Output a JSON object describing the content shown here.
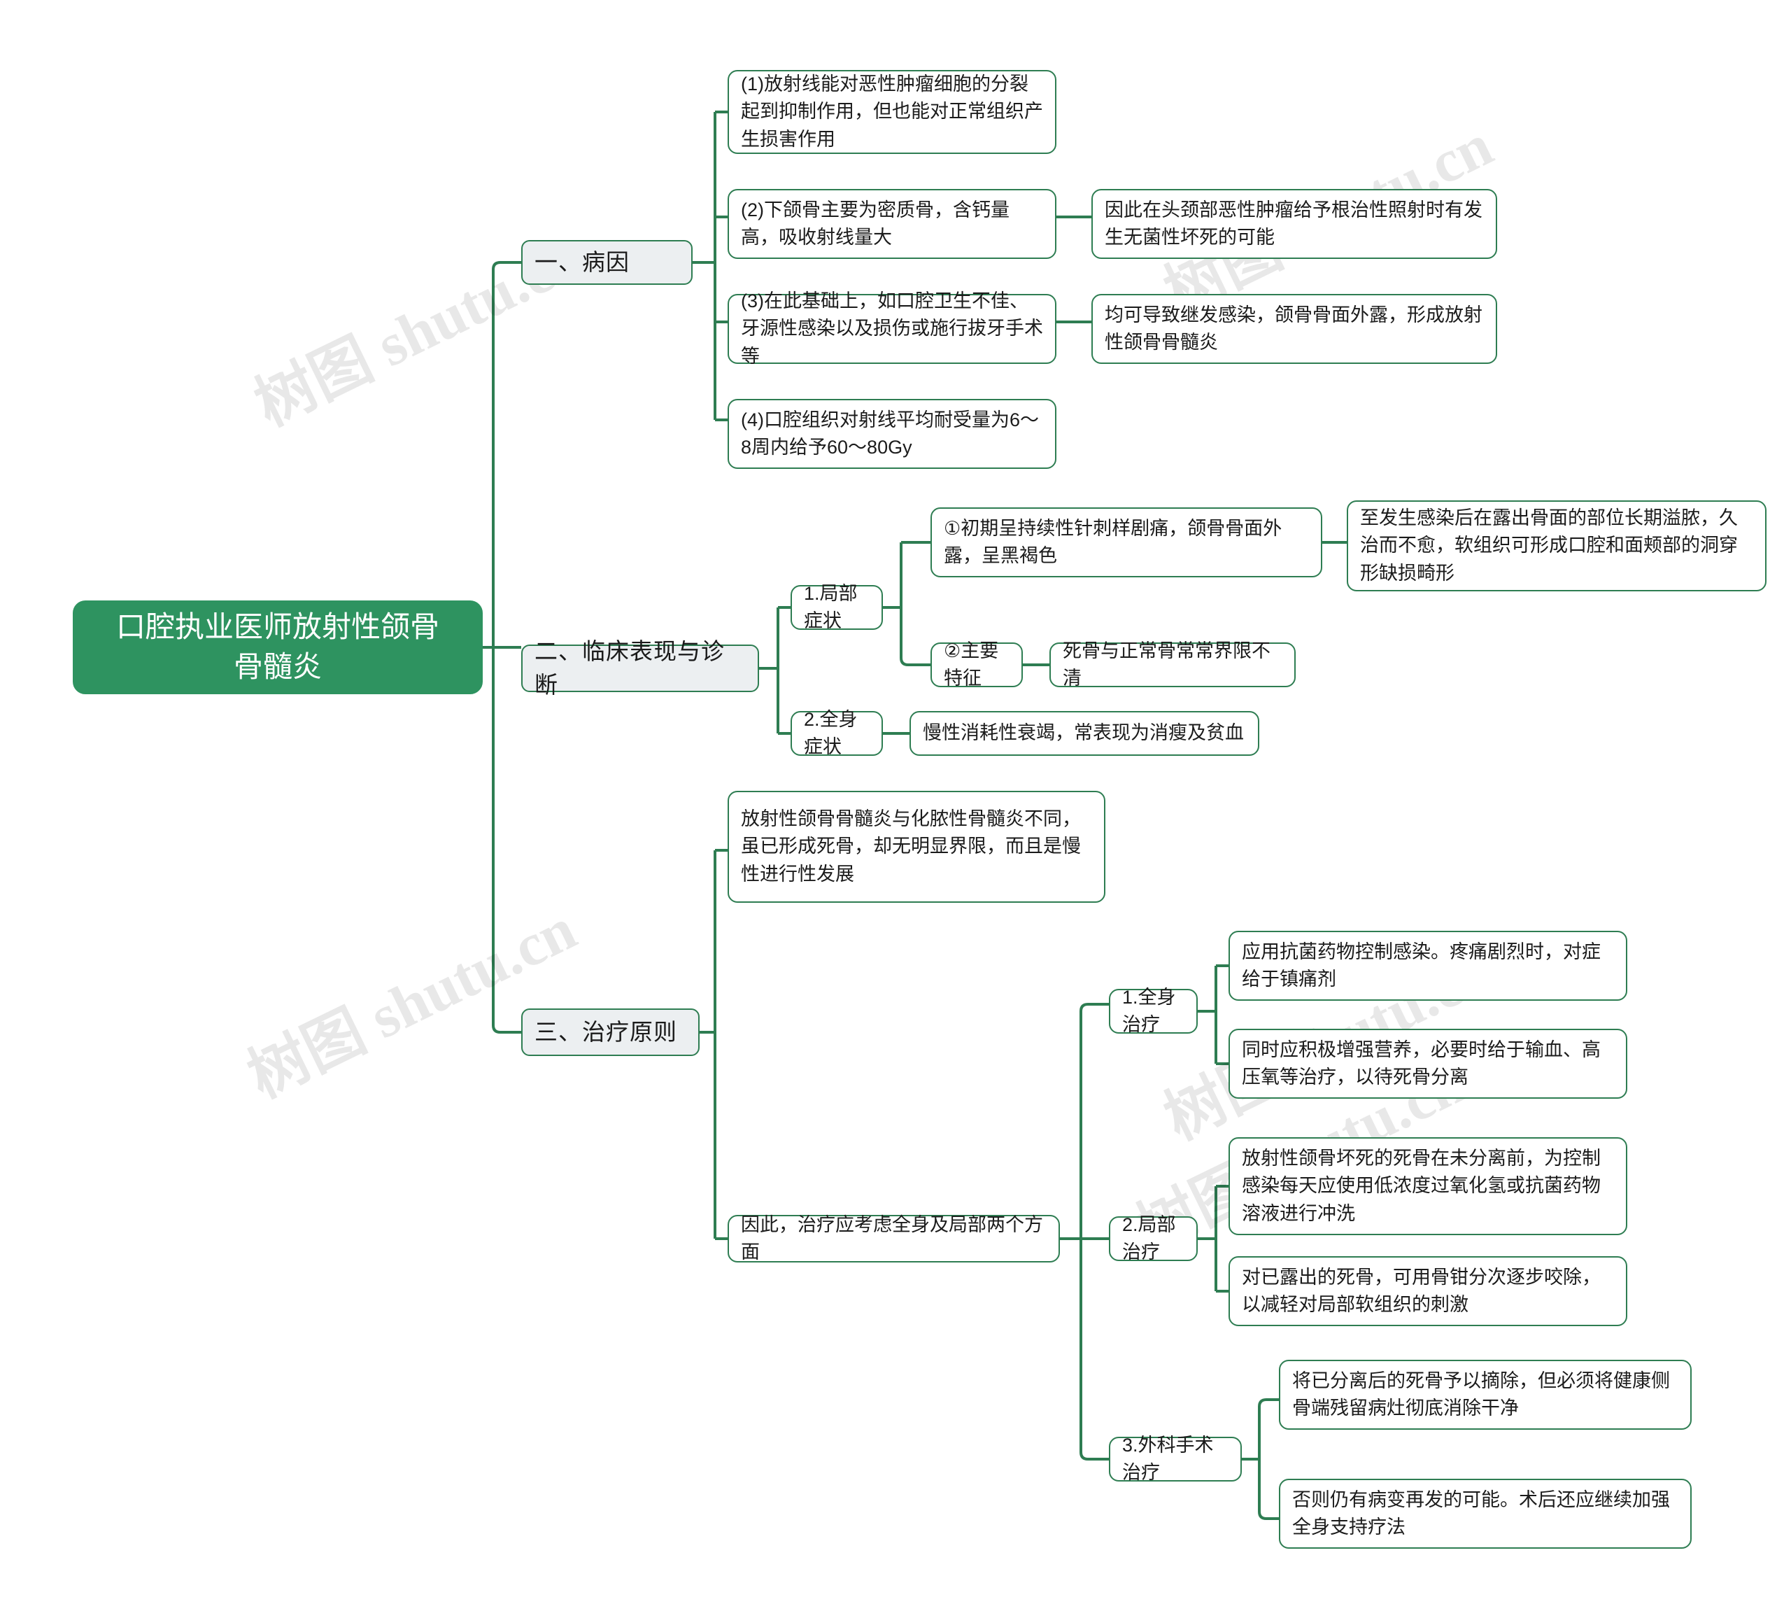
{
  "meta": {
    "title": "口腔执业医师放射性颌骨骨髓炎 思维导图",
    "accent_green": "#2e9360",
    "line_green": "#2e7d52",
    "branch_fill": "#eceff1",
    "node_fill": "#ffffff",
    "text_color": "#1b1b1b",
    "background": "#ffffff"
  },
  "watermarks": [
    {
      "text": "树图 shutu.cn"
    },
    {
      "text": "树图 shutu.cn"
    },
    {
      "text": "树图 shutu.cn"
    },
    {
      "text": "树图 shutu.cn"
    },
    {
      "text": "树图 shutu.cn"
    }
  ],
  "mindmap": {
    "root": {
      "label": "口腔执业医师放射性颌骨\n骨髓炎"
    },
    "branches": [
      {
        "label": "一、病因",
        "children": [
          {
            "label": "(1)放射线能对恶性肿瘤细胞的分裂起到抑制作用，但也能对正常组织产生损害作用",
            "children": []
          },
          {
            "label": "(2)下颌骨主要为密质骨，含钙量高，吸收射线量大",
            "children": [
              {
                "label": "因此在头颈部恶性肿瘤给予根治性照射时有发生无菌性坏死的可能"
              }
            ]
          },
          {
            "label": "(3)在此基础上，如口腔卫生不佳、牙源性感染以及损伤或施行拔牙手术等",
            "children": [
              {
                "label": "均可导致继发感染，颌骨骨面外露，形成放射性颌骨骨髓炎"
              }
            ]
          },
          {
            "label": "(4)口腔组织对射线平均耐受量为6～8周内给予60～80Gy",
            "children": []
          }
        ]
      },
      {
        "label": "二、临床表现与诊断",
        "children": [
          {
            "label": "1.局部症状",
            "children": [
              {
                "label": "①初期呈持续性针刺样剧痛，颌骨骨面外露，呈黑褐色",
                "children": [
                  {
                    "label": "至发生感染后在露出骨面的部位长期溢脓，久治而不愈，软组织可形成口腔和面颊部的洞穿形缺损畸形"
                  }
                ]
              },
              {
                "label": "②主要特征",
                "children": [
                  {
                    "label": "死骨与正常骨常常界限不清"
                  }
                ]
              }
            ]
          },
          {
            "label": "2.全身症状",
            "children": [
              {
                "label": "慢性消耗性衰竭，常表现为消瘦及贫血"
              }
            ]
          }
        ]
      },
      {
        "label": "三、治疗原则",
        "children": [
          {
            "label": "放射性颌骨骨髓炎与化脓性骨髓炎不同，虽已形成死骨，却无明显界限，而且是慢性进行性发展",
            "children": []
          },
          {
            "label": "因此，治疗应考虑全身及局部两个方面",
            "children": [
              {
                "label": "1.全身治疗",
                "children": [
                  {
                    "label": "应用抗菌药物控制感染。疼痛剧烈时，对症给于镇痛剂"
                  },
                  {
                    "label": "同时应积极增强营养，必要时给于输血、高压氧等治疗，以待死骨分离"
                  }
                ]
              },
              {
                "label": "2.局部治疗",
                "children": [
                  {
                    "label": "放射性颌骨坏死的死骨在未分离前，为控制感染每天应使用低浓度过氧化氢或抗菌药物溶液进行冲洗"
                  },
                  {
                    "label": "对已露出的死骨，可用骨钳分次逐步咬除，以减轻对局部软组织的刺激"
                  }
                ]
              },
              {
                "label": "3.外科手术治疗",
                "children": [
                  {
                    "label": "将已分离后的死骨予以摘除，但必须将健康侧骨端残留病灶彻底消除干净"
                  },
                  {
                    "label": "否则仍有病变再发的可能。术后还应继续加强全身支持疗法"
                  }
                ]
              }
            ]
          }
        ]
      }
    ]
  },
  "nodes": {
    "root": {
      "text": "口腔执业医师放射性颌骨\n骨髓炎"
    },
    "b1": {
      "text": "一、病因"
    },
    "b2": {
      "text": "二、临床表现与诊断"
    },
    "b3": {
      "text": "三、治疗原则"
    },
    "c1_1": {
      "text": "(1)放射线能对恶性肿瘤细胞的分裂起到抑制作用，但也能对正常组织产生损害作用"
    },
    "c1_2": {
      "text": "(2)下颌骨主要为密质骨，含钙量高，吸收射线量大"
    },
    "c1_2a": {
      "text": "因此在头颈部恶性肿瘤给予根治性照射时有发生无菌性坏死的可能"
    },
    "c1_3": {
      "text": "(3)在此基础上，如口腔卫生不佳、牙源性感染以及损伤或施行拔牙手术等"
    },
    "c1_3a": {
      "text": "均可导致继发感染，颌骨骨面外露，形成放射性颌骨骨髓炎"
    },
    "c1_4": {
      "text": "(4)口腔组织对射线平均耐受量为6～8周内给予60～80Gy"
    },
    "c2_1": {
      "text": "1.局部症状"
    },
    "c2_1a": {
      "text": "①初期呈持续性针刺样剧痛，颌骨骨面外露，呈黑褐色"
    },
    "c2_1a_x": {
      "text": "至发生感染后在露出骨面的部位长期溢脓，久治而不愈，软组织可形成口腔和面颊部的洞穿形缺损畸形"
    },
    "c2_1b": {
      "text": "②主要特征"
    },
    "c2_1b_x": {
      "text": "死骨与正常骨常常界限不清"
    },
    "c2_2": {
      "text": "2.全身症状"
    },
    "c2_2a": {
      "text": "慢性消耗性衰竭，常表现为消瘦及贫血"
    },
    "c3_1": {
      "text": "放射性颌骨骨髓炎与化脓性骨髓炎不同，虽已形成死骨，却无明显界限，而且是慢性进行性发展"
    },
    "c3_2": {
      "text": "因此，治疗应考虑全身及局部两个方面"
    },
    "c3_2a": {
      "text": "1.全身治疗"
    },
    "c3_2a_x1": {
      "text": "应用抗菌药物控制感染。疼痛剧烈时，对症给于镇痛剂"
    },
    "c3_2a_x2": {
      "text": "同时应积极增强营养，必要时给于输血、高压氧等治疗，以待死骨分离"
    },
    "c3_2b": {
      "text": "2.局部治疗"
    },
    "c3_2b_x1": {
      "text": "放射性颌骨坏死的死骨在未分离前，为控制感染每天应使用低浓度过氧化氢或抗菌药物溶液进行冲洗"
    },
    "c3_2b_x2": {
      "text": "对已露出的死骨，可用骨钳分次逐步咬除，以减轻对局部软组织的刺激"
    },
    "c3_2c": {
      "text": "3.外科手术治疗"
    },
    "c3_2c_x1": {
      "text": "将已分离后的死骨予以摘除，但必须将健康侧骨端残留病灶彻底消除干净"
    },
    "c3_2c_x2": {
      "text": "否则仍有病变再发的可能。术后还应继续加强全身支持疗法"
    }
  }
}
